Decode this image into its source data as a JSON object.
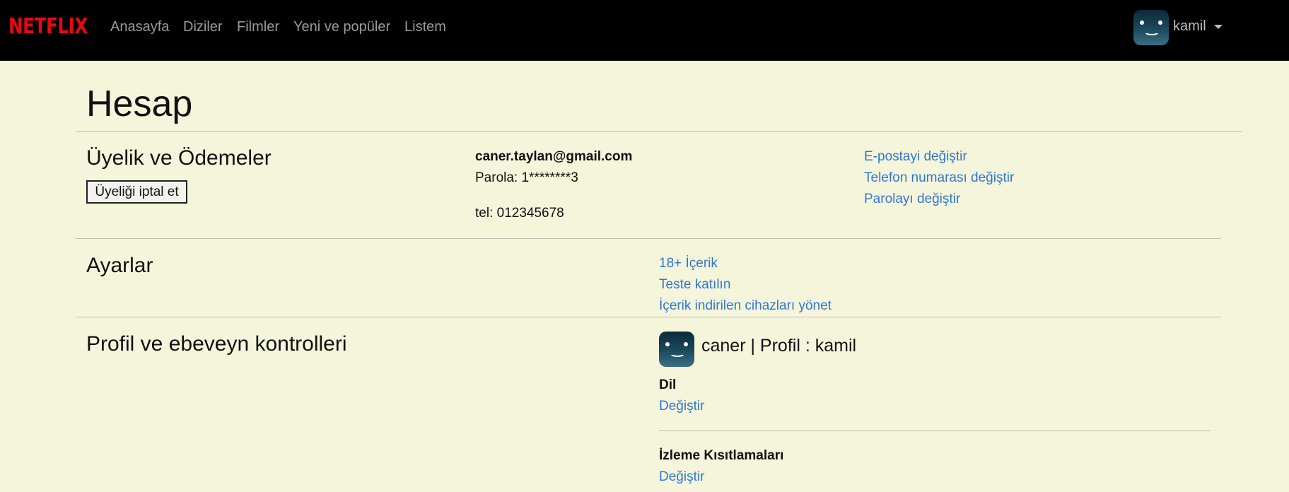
{
  "header": {
    "logo": "NETFLIX",
    "nav": [
      "Anasayfa",
      "Diziler",
      "Filmler",
      "Yeni ve popüler",
      "Listem"
    ],
    "user_name": "kamil",
    "brand_color": "#e50914"
  },
  "page": {
    "title": "Hesap"
  },
  "membership": {
    "title": "Üyelik ve Ödemeler",
    "cancel_label": "Üyeliği iptal et",
    "email": "caner.taylan@gmail.com",
    "password": "Parola: 1********3",
    "phone": "tel: 012345678",
    "links": [
      "E-postayi değiştir",
      "Telefon numarası değiştir",
      "Parolayı değiştir"
    ]
  },
  "settings": {
    "title": "Ayarlar",
    "links": [
      "18+ İçerik",
      "Teste katılın",
      "İçerik indirilen cihazları yönet"
    ]
  },
  "profile": {
    "title": "Profil ve ebeveyn kontrolleri",
    "profile_label": "caner | Profil : kamil",
    "language_heading": "Dil",
    "language_link": "Değiştir",
    "restrictions_heading": "İzleme Kısıtlamaları",
    "restrictions_link": "Değiştir"
  }
}
